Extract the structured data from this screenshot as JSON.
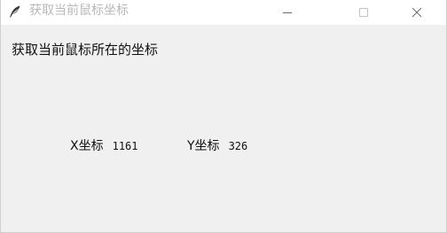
{
  "window": {
    "title": "获取当前鼠标坐标",
    "icon": "feather-icon"
  },
  "controls": {
    "minimize_icon": "minimize-icon",
    "maximize_icon": "maximize-icon",
    "close_icon": "close-icon"
  },
  "main": {
    "heading": "获取当前鼠标所在的坐标",
    "x_label": "X坐标",
    "x_value": "1161",
    "y_label": "Y坐标",
    "y_value": "326"
  }
}
